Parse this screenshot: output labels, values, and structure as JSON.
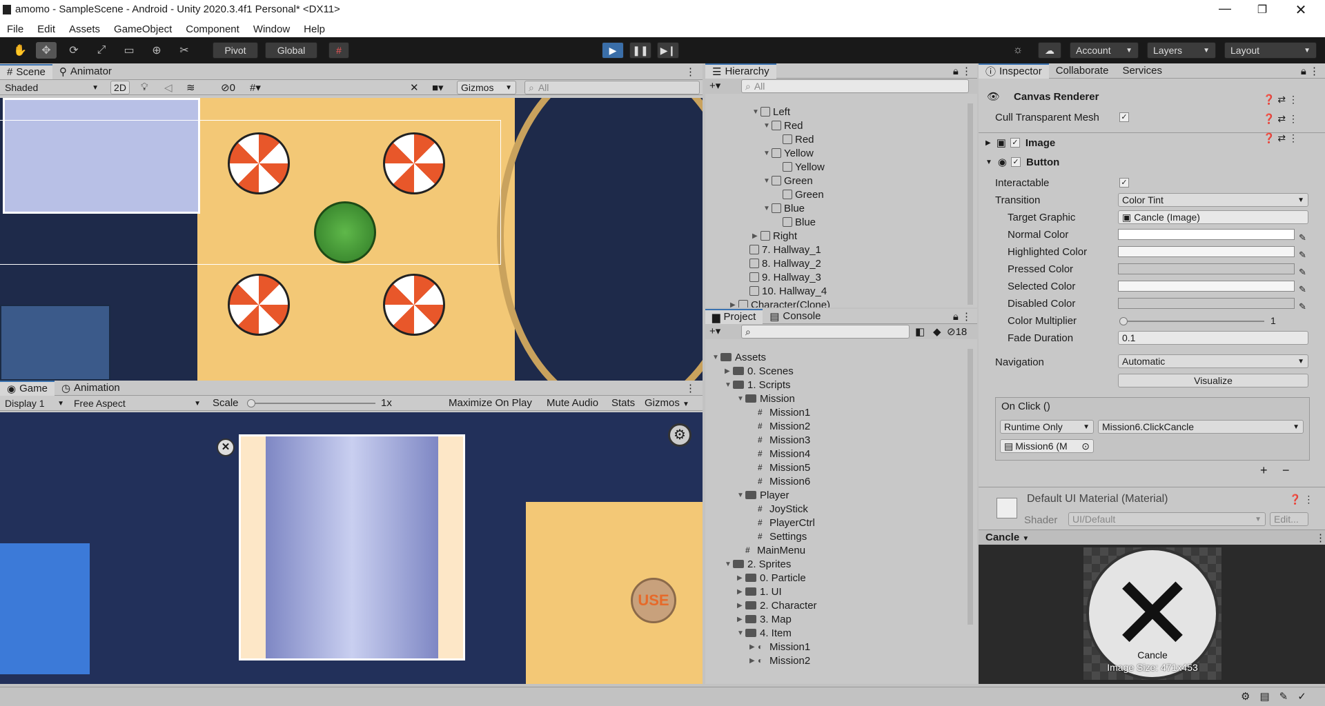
{
  "window": {
    "title": "amomo - SampleScene - Android - Unity 2020.3.4f1 Personal* <DX11>"
  },
  "menu": [
    "File",
    "Edit",
    "Assets",
    "GameObject",
    "Component",
    "Window",
    "Help"
  ],
  "toolbar": {
    "pivot": "Pivot",
    "global": "Global",
    "account": "Account",
    "layers": "Layers",
    "layout": "Layout"
  },
  "scene": {
    "tab1": "Scene",
    "tab2": "Animator",
    "shading": "Shaded",
    "mode2d": "2D",
    "hidden_count": "0",
    "gizmos": "Gizmos",
    "search_placeholder": "All"
  },
  "game": {
    "tab1": "Game",
    "tab2": "Animation",
    "display": "Display 1",
    "aspect": "Free Aspect",
    "scale_label": "Scale",
    "scale_value": "1x",
    "maximize": "Maximize On Play",
    "mute": "Mute Audio",
    "stats": "Stats",
    "gizmos": "Gizmos",
    "use_button": "USE"
  },
  "hierarchy": {
    "tab": "Hierarchy",
    "search_placeholder": "All",
    "items": [
      {
        "label": "Left",
        "indent": 3,
        "open": true
      },
      {
        "label": "Red",
        "indent": 4,
        "open": true
      },
      {
        "label": "Red",
        "indent": 5,
        "open": null
      },
      {
        "label": "Yellow",
        "indent": 4,
        "open": true
      },
      {
        "label": "Yellow",
        "indent": 5,
        "open": null
      },
      {
        "label": "Green",
        "indent": 4,
        "open": true
      },
      {
        "label": "Green",
        "indent": 5,
        "open": null
      },
      {
        "label": "Blue",
        "indent": 4,
        "open": true
      },
      {
        "label": "Blue",
        "indent": 5,
        "open": null
      },
      {
        "label": "Right",
        "indent": 3,
        "open": false
      },
      {
        "label": "7. Hallway_1",
        "indent": 2,
        "open": null
      },
      {
        "label": "8. Hallway_2",
        "indent": 2,
        "open": null
      },
      {
        "label": "9. Hallway_3",
        "indent": 2,
        "open": null
      },
      {
        "label": "10. Hallway_4",
        "indent": 2,
        "open": null
      },
      {
        "label": "Character(Clone)",
        "indent": 1,
        "open": false
      }
    ]
  },
  "project": {
    "tab1": "Project",
    "tab2": "Console",
    "hidden_count": "18",
    "items": [
      {
        "label": "Assets",
        "indent": 0,
        "kind": "folder",
        "open": true
      },
      {
        "label": "0. Scenes",
        "indent": 1,
        "kind": "folder",
        "open": false
      },
      {
        "label": "1. Scripts",
        "indent": 1,
        "kind": "folder",
        "open": true
      },
      {
        "label": "Mission",
        "indent": 2,
        "kind": "folder",
        "open": true
      },
      {
        "label": "Mission1",
        "indent": 3,
        "kind": "script",
        "open": null
      },
      {
        "label": "Mission2",
        "indent": 3,
        "kind": "script",
        "open": null
      },
      {
        "label": "Mission3",
        "indent": 3,
        "kind": "script",
        "open": null
      },
      {
        "label": "Mission4",
        "indent": 3,
        "kind": "script",
        "open": null
      },
      {
        "label": "Mission5",
        "indent": 3,
        "kind": "script",
        "open": null
      },
      {
        "label": "Mission6",
        "indent": 3,
        "kind": "script",
        "open": null
      },
      {
        "label": "Player",
        "indent": 2,
        "kind": "folder",
        "open": true
      },
      {
        "label": "JoyStick",
        "indent": 3,
        "kind": "script",
        "open": null
      },
      {
        "label": "PlayerCtrl",
        "indent": 3,
        "kind": "script",
        "open": null
      },
      {
        "label": "Settings",
        "indent": 3,
        "kind": "script",
        "open": null
      },
      {
        "label": "MainMenu",
        "indent": 2,
        "kind": "script",
        "open": null
      },
      {
        "label": "2. Sprites",
        "indent": 1,
        "kind": "folder",
        "open": true
      },
      {
        "label": "0. Particle",
        "indent": 2,
        "kind": "folder",
        "open": false
      },
      {
        "label": "1. UI",
        "indent": 2,
        "kind": "folder",
        "open": false
      },
      {
        "label": "2. Character",
        "indent": 2,
        "kind": "folder",
        "open": false
      },
      {
        "label": "3. Map",
        "indent": 2,
        "kind": "folder",
        "open": false
      },
      {
        "label": "4. Item",
        "indent": 2,
        "kind": "folder",
        "open": true
      },
      {
        "label": "Mission1",
        "indent": 3,
        "kind": "asset",
        "open": false
      },
      {
        "label": "Mission2",
        "indent": 3,
        "kind": "asset",
        "open": false
      }
    ]
  },
  "inspector": {
    "tab1": "Inspector",
    "tab2": "Collaborate",
    "tab3": "Services",
    "canvas_renderer": "Canvas Renderer",
    "cull": "Cull Transparent Mesh",
    "image": "Image",
    "button": "Button",
    "interactable": "Interactable",
    "transition": "Transition",
    "transition_value": "Color Tint",
    "target_graphic": "Target Graphic",
    "target_graphic_value": "Cancle (Image)",
    "normal": "Normal Color",
    "highlighted": "Highlighted Color",
    "pressed": "Pressed Color",
    "selected": "Selected Color",
    "disabled": "Disabled Color",
    "normal_hex": "#ffffff",
    "highlighted_hex": "#f5f5f5",
    "pressed_hex": "#c8c8c8",
    "selected_hex": "#f5f5f5",
    "disabled_hex": "#c8c8c8",
    "multiplier": "Color Multiplier",
    "multiplier_value": "1",
    "fade": "Fade Duration",
    "fade_value": "0.1",
    "navigation": "Navigation",
    "navigation_value": "Automatic",
    "visualize": "Visualize",
    "onclick": "On Click ()",
    "runtime": "Runtime Only",
    "handler": "Mission6.ClickCancle",
    "object": "Mission6 (M",
    "material": "Default UI Material (Material)",
    "shader_label": "Shader",
    "shader_value": "UI/Default",
    "edit": "Edit...",
    "preview_title": "Cancle",
    "preview_name": "Cancle",
    "preview_size": "Image Size: 471x453"
  }
}
